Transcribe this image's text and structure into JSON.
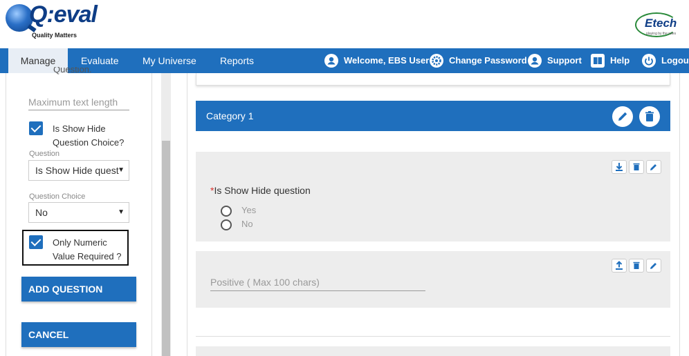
{
  "header": {
    "logo_text": "Q:eval",
    "logo_tagline": "Quality Matters",
    "brand_right": "Etech",
    "brand_right_tagline": "playing by the rules"
  },
  "nav": {
    "items": [
      {
        "label": "Manage",
        "active": true
      },
      {
        "label": "Evaluate"
      },
      {
        "label": "My Universe"
      },
      {
        "label": "Reports"
      }
    ],
    "welcome": "Welcome, EBS User",
    "change_password": "Change Password",
    "support": "Support",
    "help": "Help",
    "logout": "Logout"
  },
  "left_panel": {
    "cut_text": "Question.",
    "max_text_placeholder": "Maximum text length",
    "show_hide_label_line1": "Is Show Hide",
    "show_hide_label_line2": "Question Choice?",
    "question_label": "Question",
    "question_value": "Is Show Hide quest",
    "question_choice_label": "Question Choice",
    "question_choice_value": "No",
    "numeric_label_line1": "Only Numeric",
    "numeric_label_line2": "Value Required ?",
    "add_question_button": "ADD QUESTION",
    "cancel_button": "CANCEL"
  },
  "main": {
    "category_title": "Category 1",
    "question1": {
      "required_mark": "*",
      "text": "Is Show Hide question",
      "options": [
        "Yes",
        "No"
      ]
    },
    "question2": {
      "placeholder": "Positive ( Max 100 chars)"
    }
  },
  "colors": {
    "primary": "#1f6fbd",
    "required": "#d9302c",
    "block_bg": "#ededed"
  }
}
